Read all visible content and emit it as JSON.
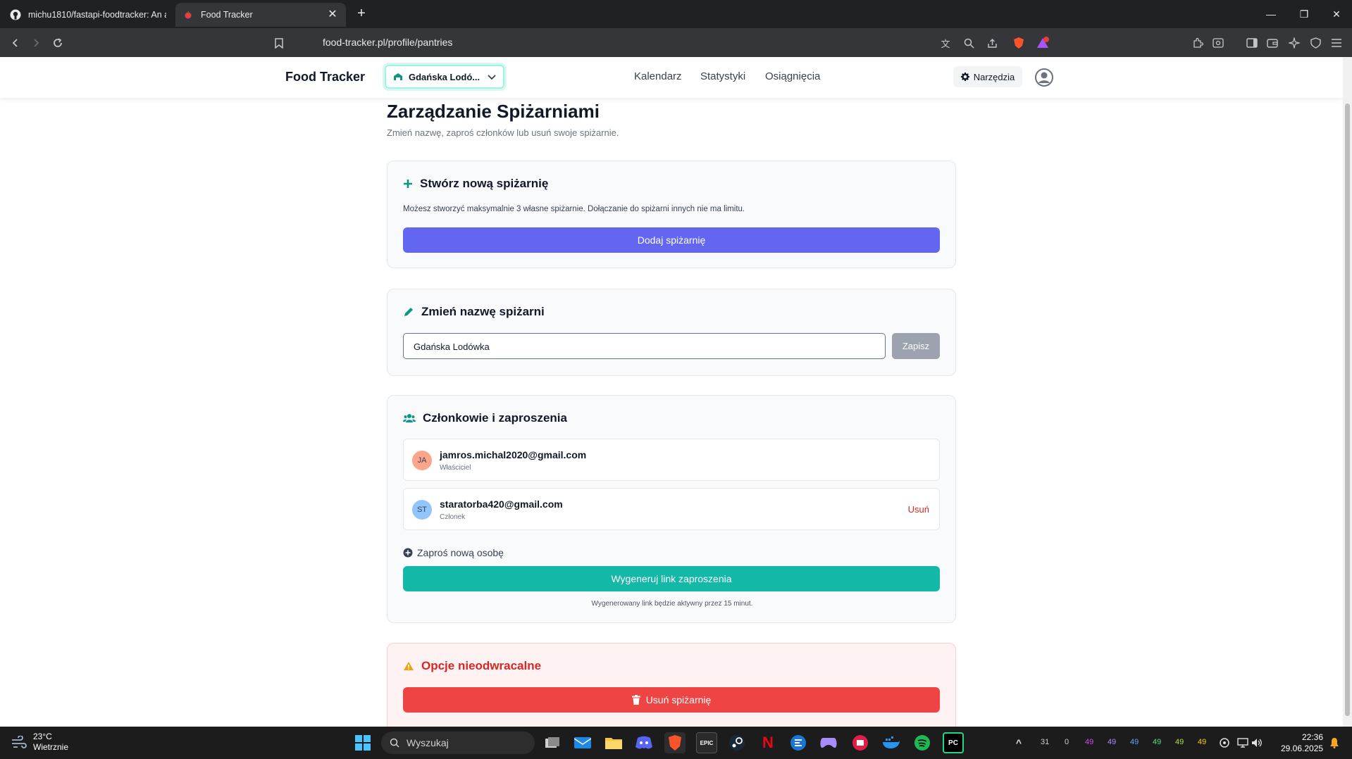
{
  "browser": {
    "tabs": [
      {
        "title": "michu1810/fastapi-foodtracker: An a"
      },
      {
        "title": "Food Tracker"
      }
    ],
    "url": "food-tracker.pl/profile/pantries"
  },
  "navbar": {
    "brand": "Food Tracker",
    "pantry_selected": "Gdańska Lodó...",
    "links": [
      "Kalendarz",
      "Statystyki",
      "Osiągnięcia"
    ],
    "tools_label": "Narzędzia"
  },
  "header": {
    "title": "Zarządzanie Spiżarniami",
    "subtitle": "Zmień nazwę, zaproś członków lub usuń swoje spiżarnie."
  },
  "create_card": {
    "title": "Stwórz nową spiżarnię",
    "description": "Możesz stworzyć maksymalnie 3 własne spiżarnie. Dołączanie do spiżarni innych nie ma limitu.",
    "button": "Dodaj spiżarnię"
  },
  "rename_card": {
    "title": "Zmień nazwę spiżarni",
    "input_value": "Gdańska Lodówka",
    "save_button": "Zapisz"
  },
  "members_card": {
    "title": "Członkowie i zaproszenia",
    "members": [
      {
        "initials": "JA",
        "email": "jamros.michal2020@gmail.com",
        "role": "Właściciel"
      },
      {
        "initials": "ST",
        "email": "staratorba420@gmail.com",
        "role": "Członek",
        "remove": "Usuń"
      }
    ],
    "invite_label": "Zaproś nową osobę",
    "invite_button": "Wygeneruj link zaproszenia",
    "invite_note": "Wygenerowany link będzie aktywny przez 15 minut."
  },
  "danger_card": {
    "title": "Opcje nieodwracalne",
    "delete_button": "Usuń spiżarnię"
  },
  "taskbar": {
    "weather_temp": "23°C",
    "weather_desc": "Wietrznie",
    "search_placeholder": "Wyszukaj",
    "tray_numbers": [
      "31",
      "0",
      "49",
      "49",
      "49",
      "49",
      "49",
      "49"
    ],
    "time": "22:36",
    "date": "29.06.2025"
  },
  "colors": {
    "primary_indigo": "#6366f1",
    "teal": "#14b8a6",
    "danger": "#ef4444",
    "save_disabled": "#9ca3af"
  }
}
